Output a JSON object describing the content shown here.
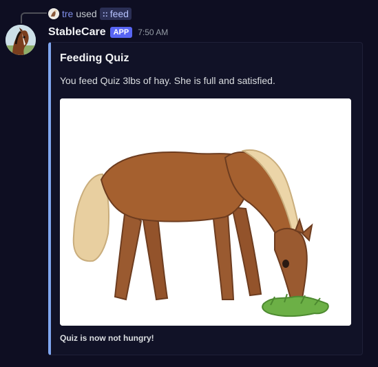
{
  "reply": {
    "user": "tre",
    "used_text": "used",
    "command_icon": "::",
    "command": "feed"
  },
  "message": {
    "username": "StableCare",
    "badge": "APP",
    "time": "7:50 AM"
  },
  "embed": {
    "title": "Feeding Quiz",
    "description": "You feed Quiz 3lbs of hay. She is full and satisfied.",
    "footer": "Quiz is now not hungry!",
    "accent_color": "#7fa6f0"
  },
  "icons": {
    "avatar": "horse-avatar-icon",
    "command": "slash-command-icon"
  }
}
